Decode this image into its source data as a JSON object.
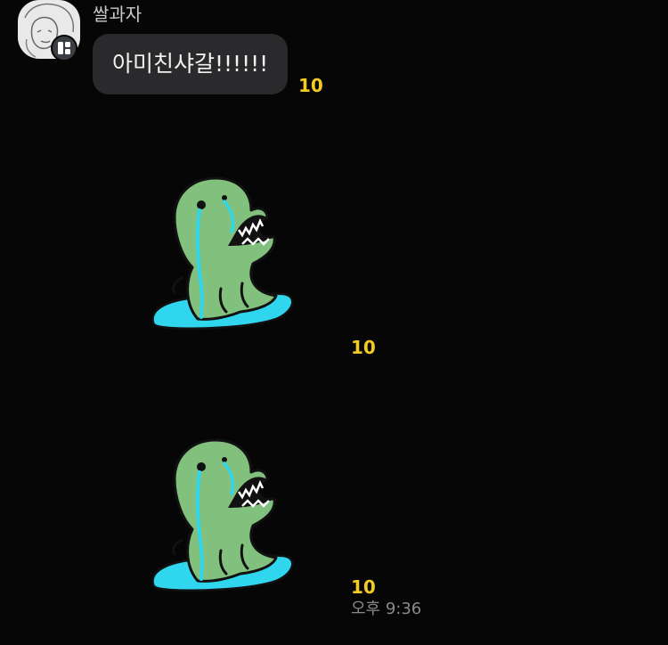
{
  "message_group": {
    "sender_name": "쌀과자",
    "messages": [
      {
        "type": "text",
        "text": "아미친샤갈!!!!!!",
        "unread_count": "10"
      },
      {
        "type": "sticker",
        "sticker": "crying-dinosaur",
        "unread_count": "10"
      },
      {
        "type": "sticker",
        "sticker": "crying-dinosaur",
        "unread_count": "10"
      }
    ],
    "timestamp": "오후 9:36"
  },
  "colors": {
    "background": "#060606",
    "bubble": "#2a2a2c",
    "unread": "#f4cc21",
    "dino": "#82c07e",
    "puddle": "#2fd6ee"
  }
}
